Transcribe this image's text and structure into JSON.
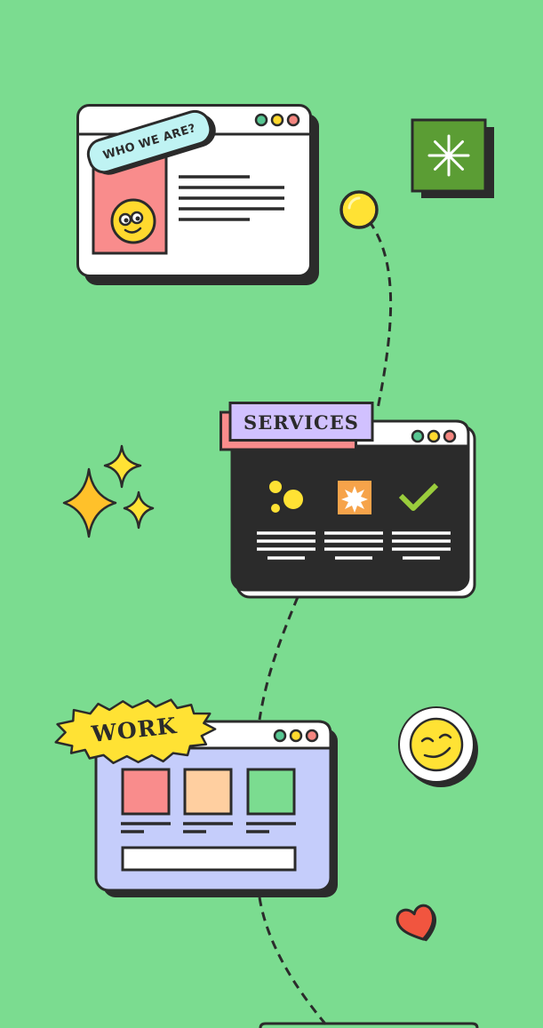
{
  "colors": {
    "background": "#7bdc90",
    "ink": "#2b2b2b",
    "yellow": "#ffe234",
    "pink": "#f98c8c",
    "lavender": "#d1c1ff",
    "cyan": "#bff3f3",
    "blue_window": "#c5cdfb",
    "peach": "#ffcfa0",
    "green_dark": "#5b9d34",
    "red_heart": "#f1553f",
    "orange_icon": "#f6a34a",
    "dot_green": "#57c692",
    "dot_yellow": "#ffd92e",
    "dot_red": "#f48680"
  },
  "cards": {
    "who": {
      "label": "WHO WE ARE?"
    },
    "services": {
      "label": "SERVICES"
    },
    "work": {
      "label": "WORK"
    }
  },
  "decor": {
    "asterisk_icon": "asterisk-icon",
    "sparkles_icon": "sparkles-icon",
    "smiley_icon": "smiley-face-icon",
    "heart_icon": "heart-icon",
    "node_icon": "yellow-dot-icon"
  }
}
